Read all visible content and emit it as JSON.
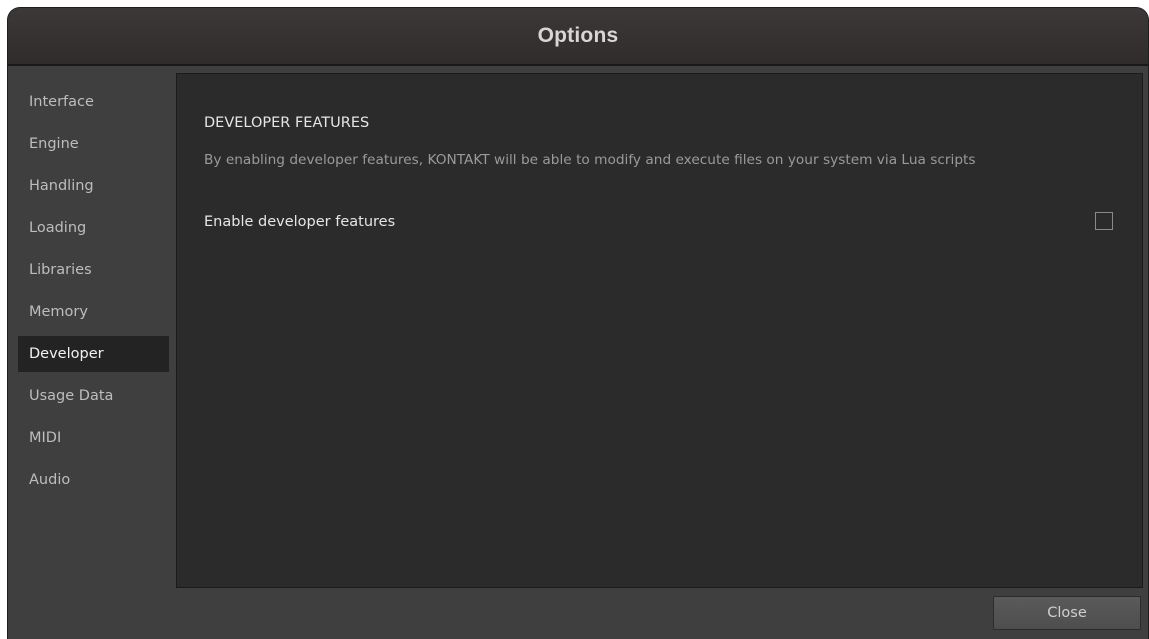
{
  "window": {
    "title": "Options"
  },
  "sidebar": {
    "items": [
      {
        "label": "Interface"
      },
      {
        "label": "Engine"
      },
      {
        "label": "Handling"
      },
      {
        "label": "Loading"
      },
      {
        "label": "Libraries"
      },
      {
        "label": "Memory"
      },
      {
        "label": "Developer",
        "active": true
      },
      {
        "label": "Usage Data"
      },
      {
        "label": "MIDI"
      },
      {
        "label": "Audio"
      }
    ]
  },
  "main": {
    "section_title": "DEVELOPER FEATURES",
    "section_description": "By enabling developer features, KONTAKT will be able to modify and execute files on your system via Lua scripts",
    "settings": [
      {
        "label": "Enable developer features",
        "checked": false
      }
    ]
  },
  "footer": {
    "close_label": "Close"
  },
  "colors": {
    "titlebar": "#302c2c",
    "window_bg": "#3f3f3f",
    "panel_bg": "#2b2b2b",
    "active_item_bg": "#232323"
  }
}
